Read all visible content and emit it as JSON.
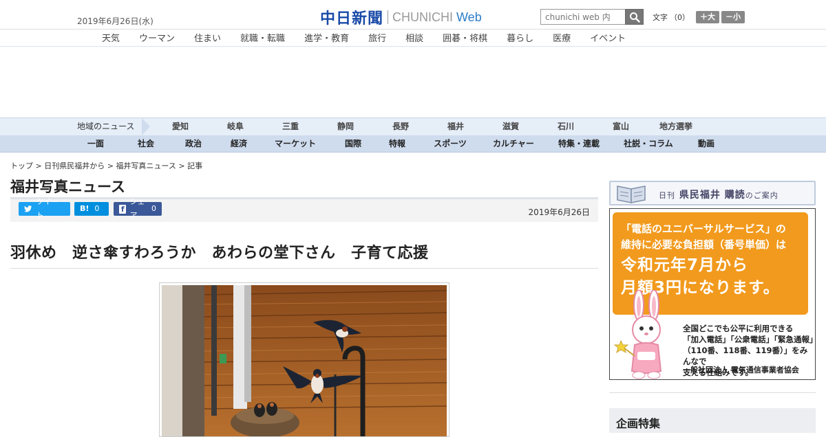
{
  "header": {
    "date": "2019年6月26日(水)",
    "logo_kanji": "中日新聞",
    "logo_latin": "CHUNICHI",
    "logo_web": "Web",
    "search_placeholder": "chunichi web 内",
    "fontsize_label": "文字",
    "fontsize_value": "（0）",
    "fontsize_bigger": "＋大",
    "fontsize_smaller": "－小"
  },
  "category_nav": [
    "天気",
    "ウーマン",
    "住まい",
    "就職・転職",
    "進学・教育",
    "旅行",
    "相談",
    "囲碁・将棋",
    "暮らし",
    "医療",
    "イベント"
  ],
  "region_nav": {
    "label": "地域のニュース",
    "items": [
      "愛知",
      "岐阜",
      "三重",
      "静岡",
      "長野",
      "福井",
      "滋賀",
      "石川",
      "富山",
      "地方選挙"
    ]
  },
  "section_nav": [
    "一面",
    "社会",
    "政治",
    "経済",
    "マーケット",
    "国際",
    "特報",
    "スポーツ",
    "カルチャー",
    "特集・連載",
    "社説・コラム",
    "動画"
  ],
  "breadcrumb": {
    "items": [
      "トップ",
      "日刊県民福井から",
      "福井写真ニュース"
    ],
    "current": "記事",
    "separator": ">"
  },
  "page": {
    "title": "福井写真ニュース",
    "date": "2019年6月26日",
    "headline": "羽休め　逆さ傘すわろうか　あわらの堂下さん　子育て応援"
  },
  "share": {
    "tweet_label": "ツイート",
    "hatena_label": "B!",
    "hatena_count": "0",
    "fb_label": "シェア",
    "fb_count": "0"
  },
  "sidebar": {
    "subscribe_banner_main": "県民福井 購読",
    "subscribe_banner_prefix": "日刊",
    "subscribe_banner_suffix": "のご案内",
    "ad": {
      "line1": "「電話のユニバーサルサービス」の",
      "line2": "維持に必要な負担額（番号単価）は",
      "line3": "令和元年7月から",
      "line4": "月額3円になります。",
      "body_lines": [
        "全国どこでも公平に利用できる",
        "「加入電話」「公衆電話」「緊急通報」",
        "（110番、118番、119番）」をみんなで",
        "支える仕組みです。"
      ],
      "org": "一般社団法人 電気通信事業者協会"
    },
    "feature_heading": "企画特集"
  },
  "colors": {
    "logo_blue": "#1a4aa8",
    "nav_light_blue": "#e6eef8",
    "nav_blue": "#cfdcee",
    "twitter": "#1da1f2",
    "hatena": "#008fde",
    "facebook": "#3b5998",
    "ad_orange": "#f29a1d"
  }
}
